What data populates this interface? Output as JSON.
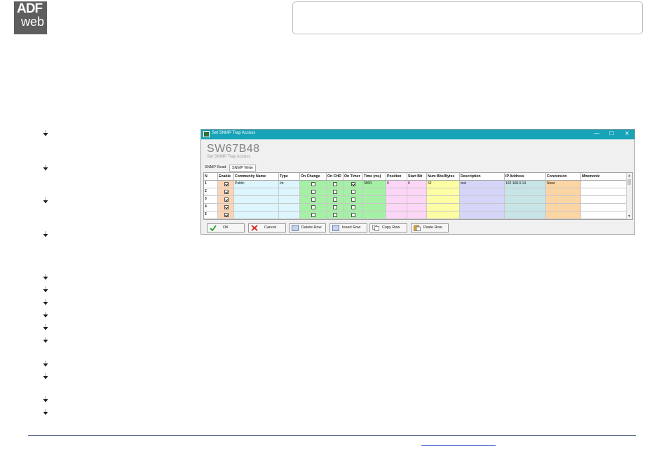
{
  "logo": {
    "line1": "ADF",
    "line2": "web"
  },
  "window": {
    "title": "Set SNMP Trap Access",
    "device_name": "SW67B48",
    "subtitle": "Set SNMP Trap Access",
    "controls": {
      "minimize": "—",
      "maximize": "☐",
      "close": "✕"
    },
    "tabs": [
      {
        "label": "SNMP Read",
        "active": true
      },
      {
        "label": "SNMP Write",
        "active": false
      }
    ],
    "table": {
      "columns": [
        "N",
        "Enable",
        "Community Name",
        "Type",
        "On Change",
        "On CHD",
        "On Timer",
        "Time (ms)",
        "Position",
        "Start Bit",
        "Num Bits/Bytes",
        "Description",
        "IP Address",
        "Conversion",
        "Mnemonic"
      ],
      "rows": [
        {
          "n": "1",
          "enable": true,
          "community": "Public",
          "type": "Int",
          "on_change": false,
          "on_chd": false,
          "on_timer": true,
          "time": "3000",
          "position": "0",
          "start_bit": "0",
          "num_bits": "32",
          "description": "test",
          "ip": "192.168.0.14",
          "conversion": "None",
          "mnemonic": ""
        },
        {
          "n": "2",
          "enable": true,
          "community": "",
          "type": "",
          "on_change": false,
          "on_chd": false,
          "on_timer": false,
          "time": "",
          "position": "",
          "start_bit": "",
          "num_bits": "",
          "description": "",
          "ip": "",
          "conversion": "",
          "mnemonic": ""
        },
        {
          "n": "3",
          "enable": true,
          "community": "",
          "type": "",
          "on_change": false,
          "on_chd": false,
          "on_timer": false,
          "time": "",
          "position": "",
          "start_bit": "",
          "num_bits": "",
          "description": "",
          "ip": "",
          "conversion": "",
          "mnemonic": ""
        },
        {
          "n": "4",
          "enable": true,
          "community": "",
          "type": "",
          "on_change": false,
          "on_chd": false,
          "on_timer": false,
          "time": "",
          "position": "",
          "start_bit": "",
          "num_bits": "",
          "description": "",
          "ip": "",
          "conversion": "",
          "mnemonic": ""
        },
        {
          "n": "5",
          "enable": true,
          "community": "",
          "type": "",
          "on_change": false,
          "on_chd": false,
          "on_timer": false,
          "time": "",
          "position": "",
          "start_bit": "",
          "num_bits": "",
          "description": "",
          "ip": "",
          "conversion": "",
          "mnemonic": ""
        }
      ]
    },
    "buttons": {
      "ok": "OK",
      "cancel": "Cancel",
      "delete_row": "Delete Row",
      "insert_row": "Insert Row",
      "copy_row": "Copy Row",
      "paste_row": "Paste Row"
    }
  },
  "colors": {
    "titlebar": "#17a3b8",
    "enable": "#fcd5b4",
    "community": "#ddf5fc",
    "on_change": "#a4f0a4",
    "position": "#fcd5f7",
    "num_bits": "#fdfda4",
    "description": "#d5d5f9",
    "ip": "#c7e5e7",
    "conversion": "#fcd5a4",
    "footer_line": "#1f3a66"
  }
}
